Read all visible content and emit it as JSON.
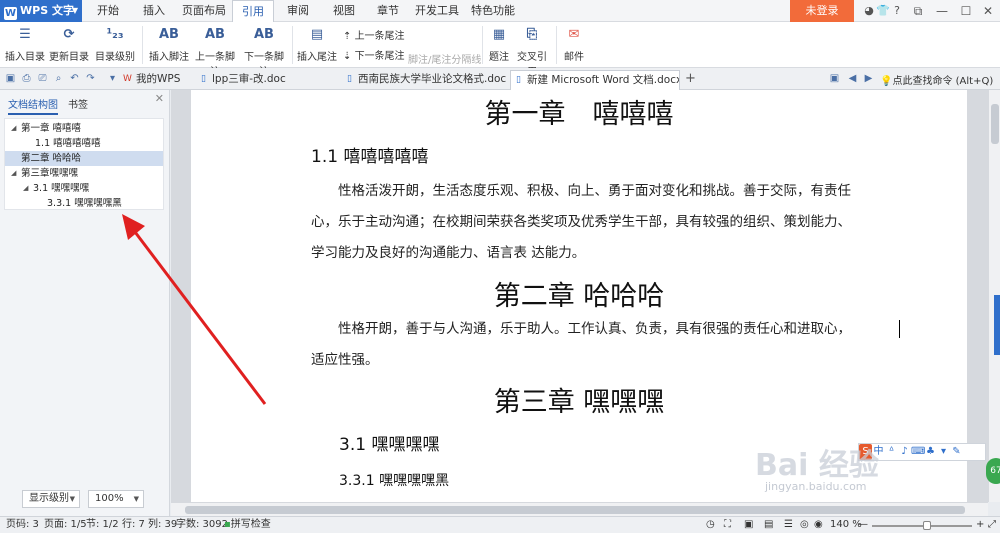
{
  "app": {
    "name": "WPS 文字",
    "logo_letter": "W"
  },
  "menu_tabs": [
    {
      "label": "开始"
    },
    {
      "label": "插入"
    },
    {
      "label": "页面布局"
    },
    {
      "label": "引用",
      "active": true
    },
    {
      "label": "审阅"
    },
    {
      "label": "视图"
    },
    {
      "label": "章节"
    },
    {
      "label": "开发工具"
    },
    {
      "label": "特色功能"
    }
  ],
  "login_label": "未登录",
  "ribbon": {
    "insert_toc": "插入目录",
    "update_toc": "更新目录",
    "toc_level": "目录级别",
    "insert_footnote": "插入脚注",
    "prev_footnote": "上一条脚注",
    "next_footnote": "下一条脚注",
    "insert_endnote": "插入尾注",
    "prev_endnote": "上一条尾注",
    "next_endnote": "下一条尾注",
    "footnote_separator": "脚注/尾注分隔线",
    "caption": "题注",
    "cross_ref": "交叉引用",
    "mail": "邮件",
    "ab": "AB"
  },
  "tabs": [
    {
      "label": "我的WPS",
      "icon": "wps-icon"
    },
    {
      "label": "lpp三审-改.doc",
      "icon": "doc-icon"
    },
    {
      "label": "西南民族大学毕业论文格式.doc",
      "icon": "doc-icon"
    },
    {
      "label": "新建 Microsoft Word 文档.docx *",
      "icon": "doc-icon",
      "active": true
    }
  ],
  "add_tab": "+",
  "find_command": "点此查找命令 (Alt+Q)",
  "nav": {
    "tab_outline": "文档结构图",
    "tab_bookmarks": "书签",
    "items": [
      {
        "label": "第一章 嘻嘻嘻",
        "level": 1,
        "expanded": true
      },
      {
        "label": "1.1 嘻嘻嘻嘻嘻",
        "level": 2
      },
      {
        "label": "第二章 哈哈哈",
        "level": 1,
        "selected": true
      },
      {
        "label": "第三章嘿嘿嘿",
        "level": 1,
        "expanded": true
      },
      {
        "label": "3.1 嘿嘿嘿嘿",
        "level": 2,
        "expanded": true
      },
      {
        "label": "3.3.1 嘿嘿嘿嘿黑",
        "level": 3
      }
    ],
    "show_level": "显示级别",
    "zoom": "100%"
  },
  "document": {
    "ch1": "第一章　嘻嘻嘻",
    "s11": "1.1  嘻嘻嘻嘻嘻",
    "p1_l1": "性格活泼开朗，生活态度乐观、积极、向上、勇于面对变化和挑战。善于交际，有责任",
    "p1_l2": "心，乐于主动沟通；在校期间荣获各类奖项及优秀学生干部，具有较强的组织、策划能力、",
    "p1_l3": "学习能力及良好的沟通能力、语言表  达能力。",
    "ch2": "第二章  哈哈哈",
    "p2_l1": "性格开朗，善于与人沟通，乐于助人。工作认真、负责，具有很强的责任心和进取心，",
    "p2_l2": "适应性强。",
    "ch3": "第三章  嘿嘿嘿",
    "s31": "3.1  嘿嘿嘿嘿",
    "s331": "3.3.1  嘿嘿嘿嘿黑"
  },
  "status": {
    "page_no": "页码: 3",
    "pages": "页面: 1/5",
    "section": "节: 1/2",
    "row": "行: 7",
    "col": "列: 39",
    "words": "字数: 3092",
    "spell": "拼写检查",
    "zoom": "140 %"
  },
  "watermark": {
    "logo": "Bai 经验",
    "url": "jingyan.baidu.com"
  },
  "ime": {
    "s": "S",
    "zh": "中"
  },
  "green_badge": "67",
  "colors": {
    "accent": "#2f6fcb",
    "login": "#f26b3a",
    "nav_selected": "#cfdcef",
    "arrow": "#e02020"
  }
}
